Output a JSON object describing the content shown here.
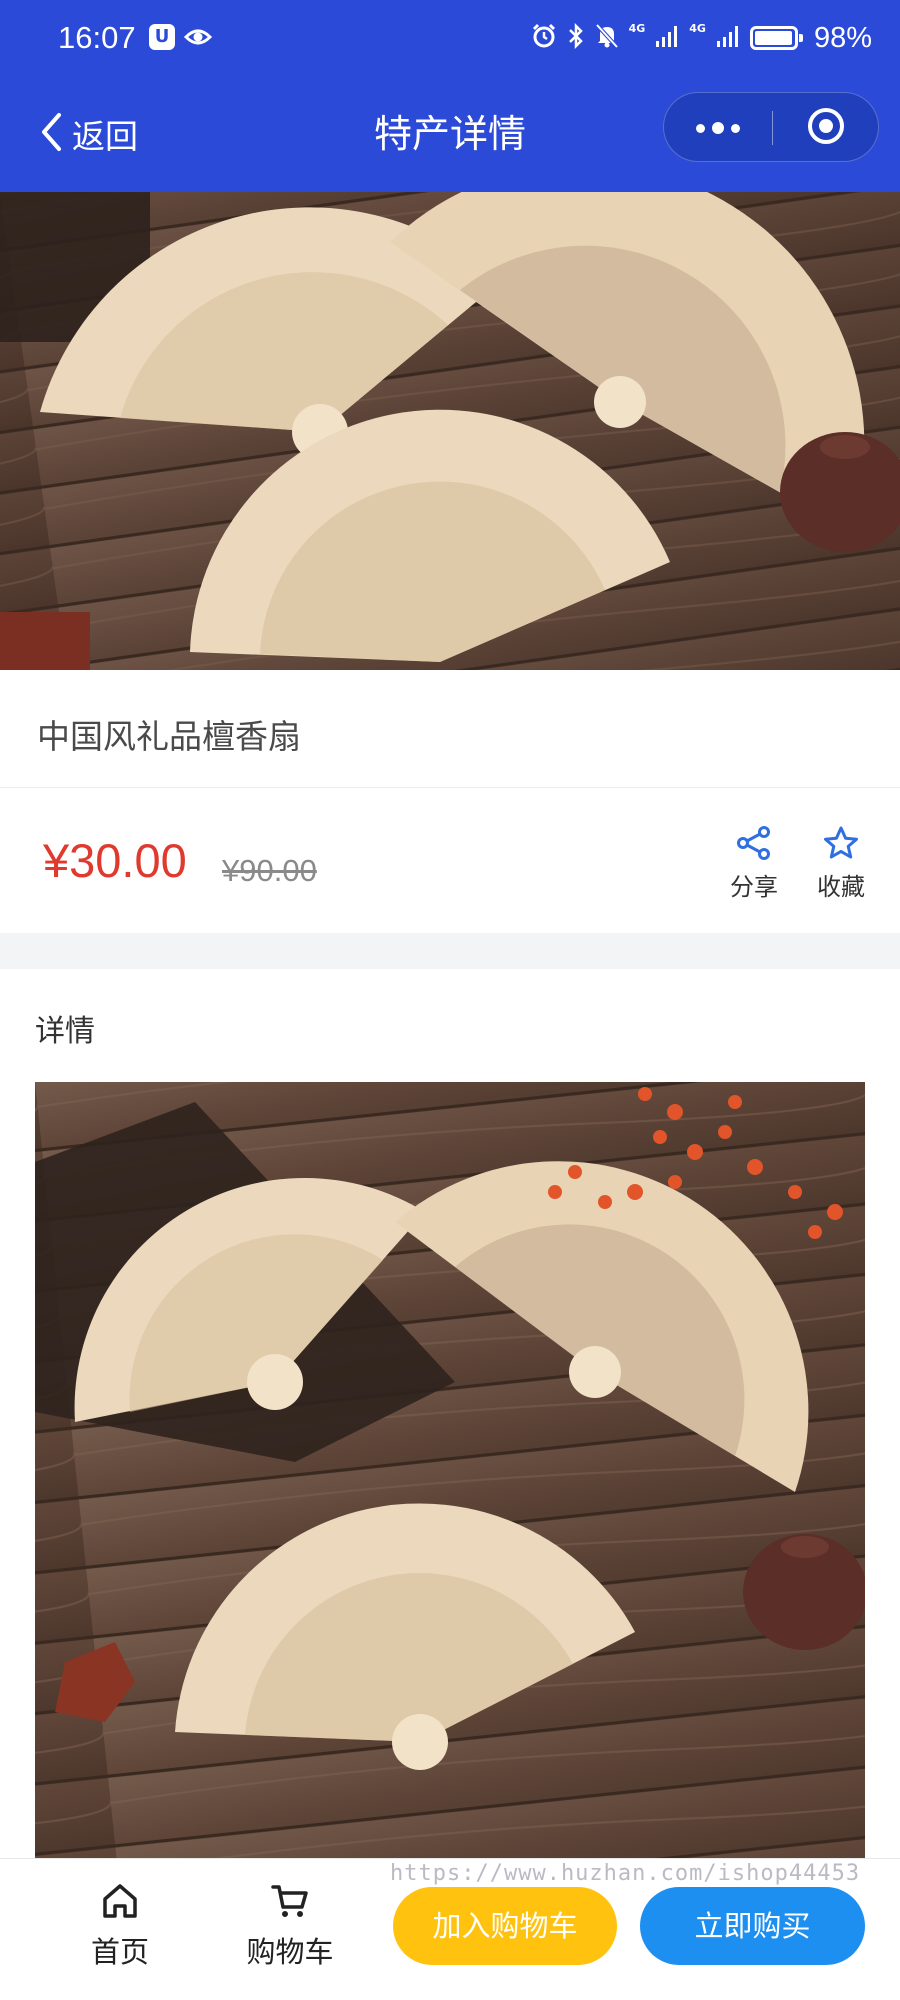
{
  "status_bar": {
    "time": "16:07",
    "badge": "U",
    "network_1": "4G",
    "network_2": "4G",
    "battery_percent": "98%",
    "battery_level": 0.98,
    "icons": [
      "eye-icon",
      "alarm-icon",
      "bluetooth-icon",
      "mute-icon",
      "signal-icon",
      "signal-icon",
      "battery-icon"
    ]
  },
  "nav": {
    "back_label": "返回",
    "title": "特产详情",
    "icons": [
      "chevron-left-icon",
      "more-icon",
      "target-icon"
    ]
  },
  "product": {
    "title": "中国风礼品檀香扇",
    "price_current": "¥30.00",
    "price_original": "¥90.00"
  },
  "actions": {
    "share_label": "分享",
    "favorite_label": "收藏"
  },
  "detail": {
    "heading": "详情"
  },
  "bottom_bar": {
    "home_label": "首页",
    "cart_label": "购物车",
    "add_to_cart_label": "加入购物车",
    "buy_now_label": "立即购买",
    "watermark": "https://www.huzhan.com/ishop44453"
  },
  "colors": {
    "header_bg": "#2c4ad8",
    "price_red": "#e0392d",
    "add_to_cart": "#ffc30f",
    "buy_now": "#1d8ff0",
    "accent_icon": "#2f6fe0"
  }
}
